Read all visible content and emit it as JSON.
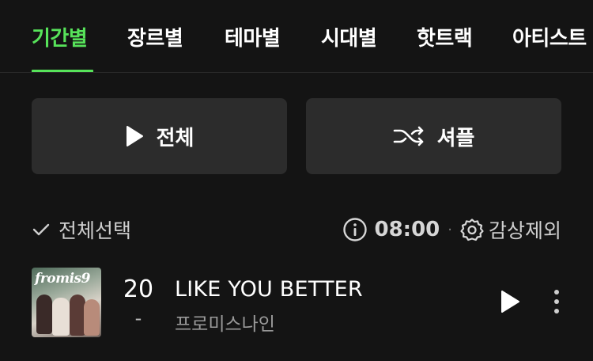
{
  "tabs": [
    {
      "label": "기간별",
      "active": true
    },
    {
      "label": "장르별",
      "active": false
    },
    {
      "label": "테마별",
      "active": false
    },
    {
      "label": "시대별",
      "active": false
    },
    {
      "label": "핫트랙",
      "active": false
    },
    {
      "label": "아티스트",
      "active": false
    }
  ],
  "actions": {
    "play_all_label": "전체",
    "shuffle_label": "셔플"
  },
  "toolbar": {
    "select_all_label": "전체선택",
    "duration": "08:00",
    "separator": "·",
    "exclude_label": "감상제외"
  },
  "tracks": [
    {
      "album_logo": "fromis9",
      "rank": "20",
      "rank_change": "-",
      "title": "LIKE YOU BETTER",
      "artist": "프로미스나인"
    }
  ],
  "colors": {
    "accent": "#57e35a",
    "background": "#141414",
    "button_bg": "#2c2c2c"
  },
  "icons": {
    "play": "play-icon",
    "shuffle": "shuffle-icon",
    "check": "check-icon",
    "info": "info-icon",
    "settings": "gear-icon",
    "more": "more-vertical-icon"
  }
}
